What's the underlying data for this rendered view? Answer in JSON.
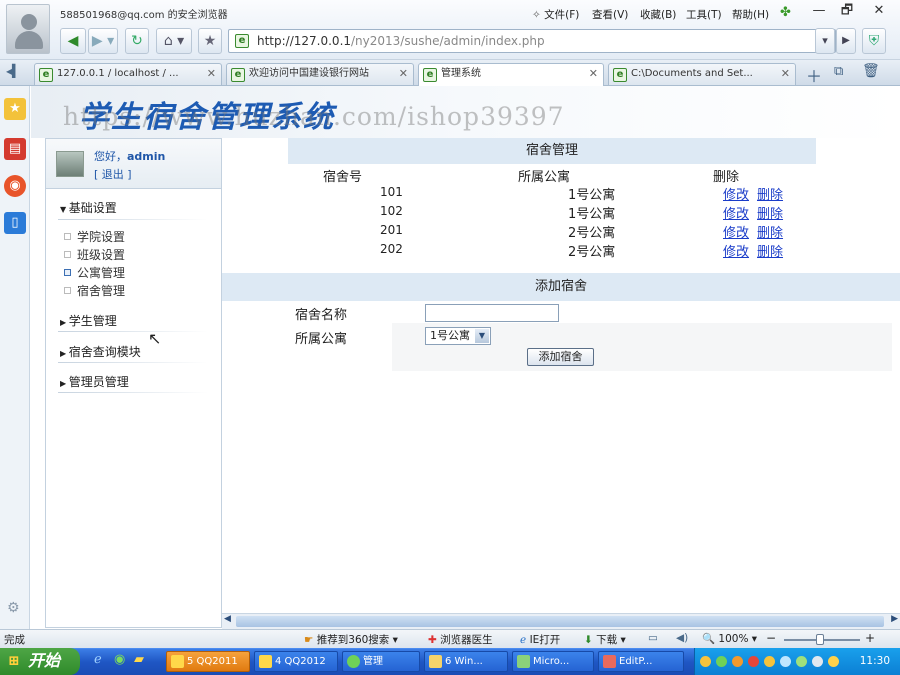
{
  "browser": {
    "account": "588501968@qq.com 的安全浏览器",
    "menus": [
      "文件(F)",
      "查看(V)",
      "收藏(B)",
      "工具(T)",
      "帮助(H)"
    ],
    "window_buttons": [
      "—",
      "🗗",
      "✕"
    ]
  },
  "address": {
    "host": "http://127.0.0.1",
    "path": "/ny2013/sushe/admin/index.php"
  },
  "tabs": [
    {
      "label": "127.0.0.1 / localhost / ...",
      "active": false
    },
    {
      "label": "欢迎访问中国建设银行网站",
      "active": false
    },
    {
      "label": "管理系统",
      "active": true
    },
    {
      "label": "C:\\Documents and Set...",
      "active": false
    }
  ],
  "page": {
    "banner_title": "学生宿舍管理系统",
    "watermark": "https://www.huzhan.com/ishop39397"
  },
  "user": {
    "greeting": "您好，",
    "name": "admin",
    "logout": "[ 退出 ]"
  },
  "sidebar": {
    "groups": [
      {
        "label": "基础设置",
        "expanded": true,
        "items": [
          {
            "label": "学院设置",
            "selected": false
          },
          {
            "label": "班级设置",
            "selected": false
          },
          {
            "label": "公寓管理",
            "selected": true
          },
          {
            "label": "宿舍管理",
            "selected": false
          }
        ]
      },
      {
        "label": "学生管理",
        "expanded": false
      },
      {
        "label": "宿舍查询模块",
        "expanded": false
      },
      {
        "label": "管理员管理",
        "expanded": false
      }
    ]
  },
  "dorm_list": {
    "title": "宿舍管理",
    "columns": [
      "宿舍号",
      "所属公寓",
      "删除"
    ],
    "rows": [
      {
        "number": "101",
        "apartment": "1号公寓"
      },
      {
        "number": "102",
        "apartment": "1号公寓"
      },
      {
        "number": "201",
        "apartment": "2号公寓"
      },
      {
        "number": "202",
        "apartment": "2号公寓"
      }
    ],
    "edit_label": "修改",
    "delete_label": "删除"
  },
  "add_form": {
    "title": "添加宿舍",
    "name_label": "宿舍名称",
    "name_value": "",
    "apartment_label": "所属公寓",
    "apartment_selected": "1号公寓",
    "submit_label": "添加宿舍"
  },
  "statusbar": {
    "status": "完成",
    "recommend": "推荐到360搜索",
    "doctor": "浏览器医生",
    "ie_open": "IE打开",
    "download": "下载",
    "zoom": "100%"
  },
  "taskbar": {
    "start": "开始",
    "tasks": [
      {
        "label": "5 QQ2011",
        "color": "orange"
      },
      {
        "label": "4 QQ2012",
        "color": "blue"
      },
      {
        "label": "管理",
        "color": "blue"
      },
      {
        "label": "6 Win...",
        "color": "blue"
      },
      {
        "label": "Micro...",
        "color": "blue"
      },
      {
        "label": "EditP...",
        "color": "blue"
      }
    ],
    "clock": "11:30"
  },
  "colors": {
    "accent": "#1f56a8",
    "link": "#1a3cc9",
    "section_bg": "#dde9f4",
    "taskbar": "#1f56c4"
  }
}
